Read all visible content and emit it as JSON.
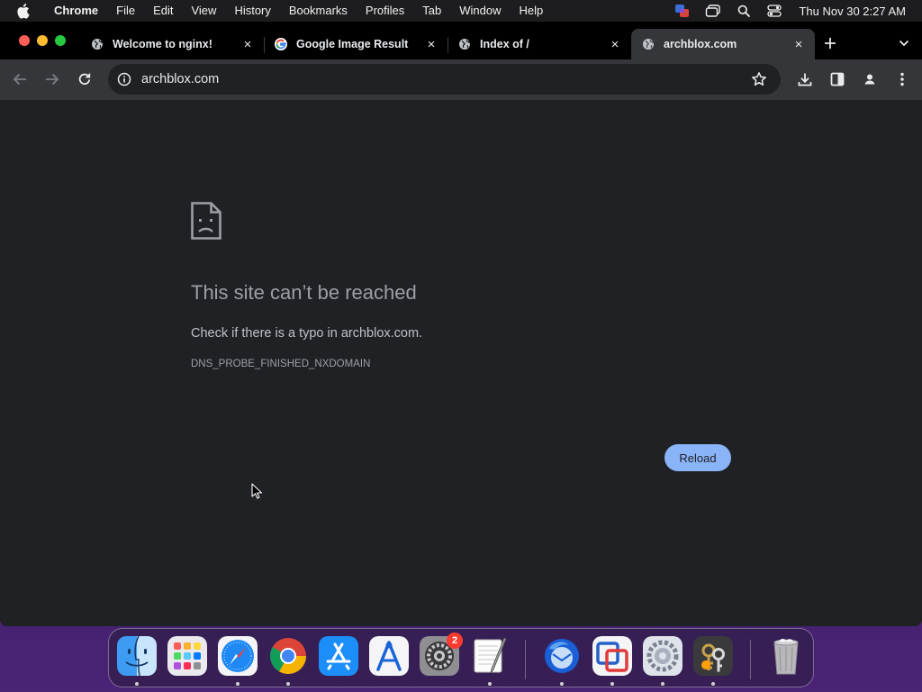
{
  "menubar": {
    "app_name": "Chrome",
    "items": [
      "File",
      "Edit",
      "View",
      "History",
      "Bookmarks",
      "Profiles",
      "Tab",
      "Window",
      "Help"
    ],
    "clock": "Thu Nov 30  2:27 AM"
  },
  "tabs": [
    {
      "title": "Welcome to nginx!",
      "icon": "globe-icon",
      "close": "×"
    },
    {
      "title": "Google Image Result",
      "icon": "google-icon",
      "close": "×"
    },
    {
      "title": "Index of /",
      "icon": "globe-icon",
      "close": "×"
    },
    {
      "title": "archblox.com",
      "icon": "globe-icon",
      "close": "×",
      "active": true
    }
  ],
  "omnibox": {
    "url": "archblox.com"
  },
  "error_page": {
    "heading": "This site can’t be reached",
    "message": "Check if there is a typo in archblox.com.",
    "error_code": "DNS_PROBE_FINISHED_NXDOMAIN",
    "reload_label": "Reload"
  },
  "dock": {
    "apps": [
      "finder",
      "launchpad",
      "safari",
      "chrome",
      "app-store",
      "xcode-instruments",
      "system-settings",
      "textedit",
      "thunderbird",
      "parallels",
      "system-preferences",
      "keychain-access",
      "trash"
    ],
    "system_settings_badge": "2"
  },
  "colors": {
    "accent": "#8ab4f8",
    "window_bg": "#202124",
    "toolbar_bg": "#35363a"
  }
}
